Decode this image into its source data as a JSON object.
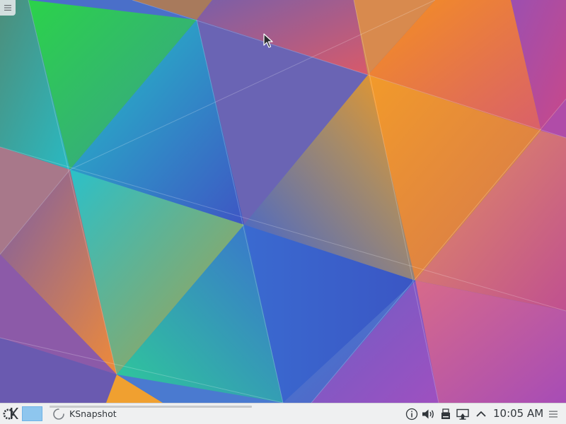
{
  "desktop": {
    "wallpaper_name": "kde-plasma-triangles-wallpaper",
    "colors": {
      "green": "#2bd24a",
      "teal": "#2ab9c2",
      "blue": "#3a6bd0",
      "purple": "#7e55c6",
      "magenta": "#c2488e",
      "orange": "#f39a2d",
      "red": "#d85a5a"
    }
  },
  "panel": {
    "background": "#eff0f1",
    "launcher_icon": "kde-logo-icon",
    "pager": {
      "active_desktop_color": "#8ec6ee"
    },
    "tasks": [
      {
        "label": "KSnapshot",
        "icon": "loading-spinner-icon",
        "state": "starting"
      }
    ],
    "tray_icons": [
      "info-icon",
      "volume-icon",
      "storage-device-icon",
      "display-icon",
      "expand-tray-arrow-icon"
    ],
    "clock": {
      "time": "10:05 AM"
    },
    "menu_icon": "hamburger-menu-icon"
  }
}
